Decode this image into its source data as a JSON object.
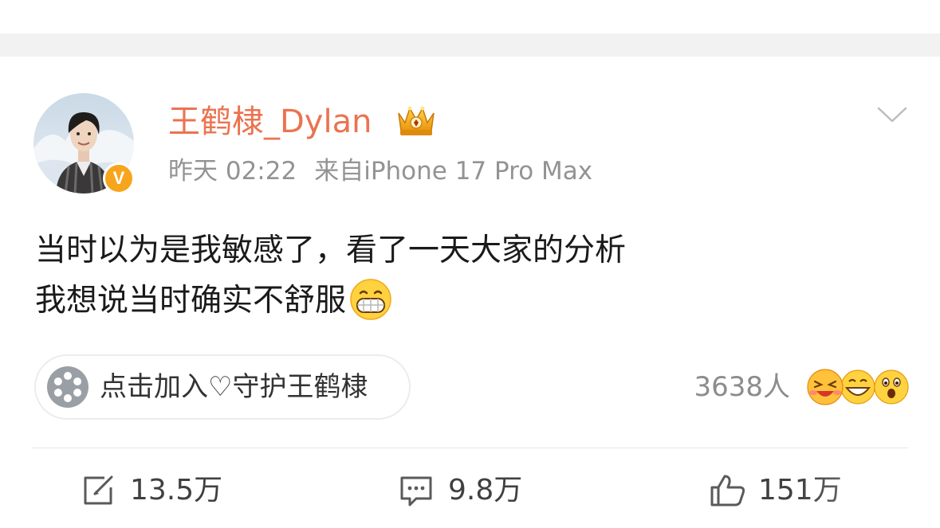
{
  "post": {
    "author": {
      "name": "王鹤棣_Dylan",
      "verified_color": "#f7a51c",
      "avatar": "avatar-photo",
      "badge_icon": "crown-icon"
    },
    "meta": {
      "time": "昨天 02:22",
      "source": "来自iPhone 17 Pro Max"
    },
    "menu_icon": "chevron-down-icon",
    "text_lines": [
      "当时以为是我敏感了，看了一天大家的分析",
      "我想说当时确实不舒服"
    ],
    "inline_emoji": "grin-emoji-icon"
  },
  "guard": {
    "label": "点击加入♡守护王鹤棣",
    "icon": "asterisk-icon"
  },
  "reactions": {
    "count": "3638人",
    "emojis": [
      "laugh-tears-icon",
      "grin-squint-icon",
      "shocked-icon"
    ]
  },
  "actions": {
    "repost": {
      "count": "13.5万",
      "icon": "repost-icon"
    },
    "comment": {
      "count": "9.8万",
      "icon": "comment-icon"
    },
    "like": {
      "count": "151万",
      "icon": "thumbs-up-icon"
    }
  },
  "colors": {
    "username": "#eb7350",
    "meta": "#939393",
    "text": "#1a1a1a",
    "separator": "#f2f2f2"
  }
}
